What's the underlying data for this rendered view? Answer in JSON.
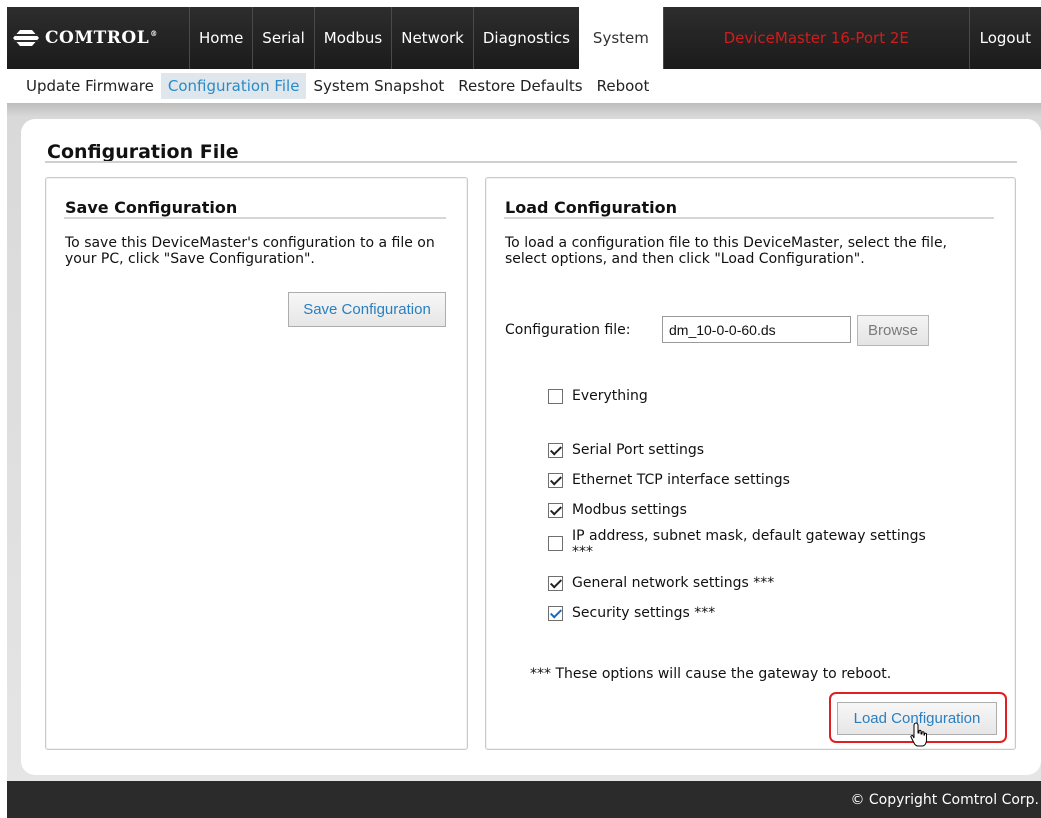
{
  "brand": {
    "logo_text": "COMTROL",
    "logo_registered": "®"
  },
  "nav": {
    "tabs": [
      {
        "label": "Home",
        "active": false
      },
      {
        "label": "Serial",
        "active": false
      },
      {
        "label": "Modbus",
        "active": false
      },
      {
        "label": "Network",
        "active": false
      },
      {
        "label": "Diagnostics",
        "active": false
      },
      {
        "label": "System",
        "active": true
      }
    ],
    "device_name": "DeviceMaster 16-Port 2E",
    "device_name_color": "#d11c1c",
    "logout_label": "Logout"
  },
  "subnav": {
    "items": [
      {
        "label": "Update Firmware",
        "active": false
      },
      {
        "label": "Configuration File",
        "active": true
      },
      {
        "label": "System Snapshot",
        "active": false
      },
      {
        "label": "Restore Defaults",
        "active": false
      },
      {
        "label": "Reboot",
        "active": false
      }
    ]
  },
  "page": {
    "title": "Configuration File"
  },
  "save_panel": {
    "title": "Save Configuration",
    "description": "To save this DeviceMaster's configuration to a file on your PC, click \"Save Configuration\".",
    "button_label": "Save Configuration"
  },
  "load_panel": {
    "title": "Load Configuration",
    "description": "To load a configuration file to this DeviceMaster, select the file, select options, and then click \"Load Configuration\".",
    "file_label": "Configuration file:",
    "file_value": "dm_10-0-0-60.ds",
    "browse_label": "Browse",
    "options": {
      "everything": {
        "label": "Everything",
        "checked": false
      },
      "serial_port": {
        "label": "Serial Port settings",
        "checked": true
      },
      "ethernet_tcp": {
        "label": "Ethernet TCP interface settings",
        "checked": true
      },
      "modbus": {
        "label": "Modbus settings",
        "checked": true
      },
      "ip_address": {
        "label": "IP address, subnet mask, default gateway settings ***",
        "checked": false
      },
      "general_network": {
        "label": "General network settings ***",
        "checked": true
      },
      "security": {
        "label": "Security settings ***",
        "checked": true
      }
    },
    "reboot_note": "*** These options will cause the gateway to reboot.",
    "button_label": "Load Configuration",
    "highlight_color": "#e02020"
  },
  "footer": {
    "copyright": "© Copyright Comtrol Corp."
  }
}
